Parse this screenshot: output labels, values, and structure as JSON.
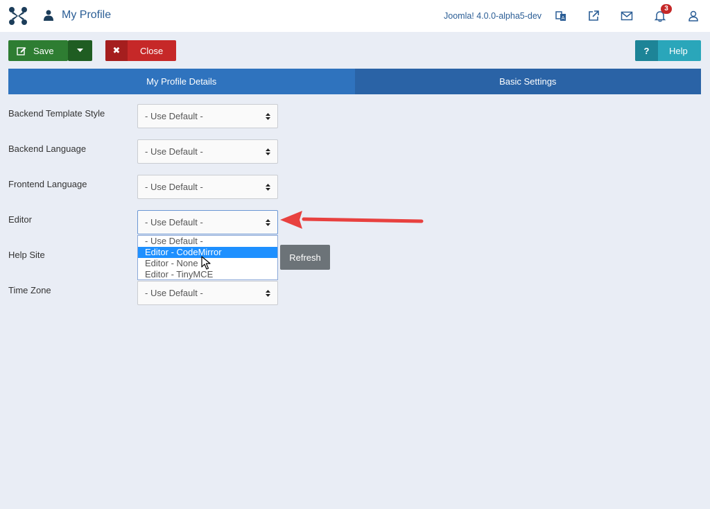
{
  "header": {
    "title": "My Profile",
    "version": "Joomla! 4.0.0-alpha5-dev",
    "notification_count": "3",
    "icons": [
      "joomla-logo-icon",
      "user-icon",
      "language-icon",
      "external-link-icon",
      "mail-icon",
      "bell-icon",
      "account-icon"
    ]
  },
  "toolbar": {
    "save_label": "Save",
    "close_label": "Close",
    "help_label": "Help",
    "help_symbol": "?",
    "close_symbol": "✖"
  },
  "tabs": [
    {
      "label": "My Profile Details",
      "active": true
    },
    {
      "label": "Basic Settings",
      "active": false
    }
  ],
  "form": {
    "fields": [
      {
        "label": "Backend Template Style",
        "value": "- Use Default -"
      },
      {
        "label": "Backend Language",
        "value": "- Use Default -"
      },
      {
        "label": "Frontend Language",
        "value": "- Use Default -"
      },
      {
        "label": "Editor",
        "value": "- Use Default -"
      },
      {
        "label": "Help Site",
        "value": ""
      },
      {
        "label": "Time Zone",
        "value": "- Use Default -"
      }
    ],
    "editor_options": [
      "- Use Default -",
      "Editor - CodeMirror",
      "Editor - None",
      "Editor - TinyMCE"
    ],
    "editor_highlighted": 1,
    "refresh_label": "Refresh"
  },
  "colors": {
    "save": "#2e7d32",
    "close": "#c62828",
    "help": "#2aa6ba",
    "tab_active": "#2f73be",
    "tab_inactive": "#2a63a6",
    "annotation_arrow": "#e8413f"
  }
}
